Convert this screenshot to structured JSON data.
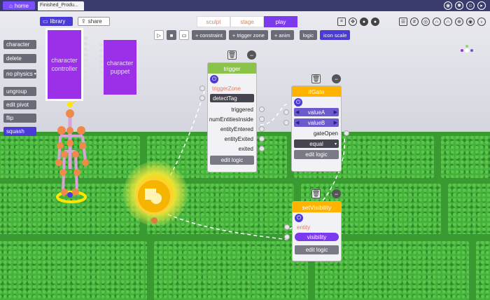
{
  "topbar": {
    "home_label": "home",
    "file_tab": "Finished_Produ...",
    "icons": [
      "github-icon",
      "settings-icon",
      "discord-icon",
      "youtube-icon"
    ]
  },
  "library": {
    "library_label": "library",
    "share_label": "share"
  },
  "mode_tabs": [
    {
      "label": "sculpt",
      "active": false
    },
    {
      "label": "stage",
      "active": false
    },
    {
      "label": "play",
      "active": true
    }
  ],
  "toolbar": {
    "constraint": "constraint",
    "trigger_zone": "trigger zone",
    "anim": "anim",
    "logic": "logic",
    "icon_scale": "icon scale"
  },
  "left_panel": {
    "character": "character",
    "delete": "delete",
    "physics": "no physics",
    "ungroup": "ungroup",
    "edit_pivot": "edit pivot",
    "flip": "flip",
    "squash": "squash"
  },
  "palette": {
    "controller": "character controller",
    "puppet": "character puppet"
  },
  "trigger_node": {
    "title": "trigger",
    "input_label": "triggerZone",
    "tag_field": "detectTag",
    "outputs": [
      "triggered",
      "numEntitiesInside",
      "entityEntered",
      "entityExited",
      "exited"
    ],
    "edit_logic": "edit logic"
  },
  "ifgate_node": {
    "title": "ifGate",
    "value_a": "valueA",
    "value_b": "valueB",
    "output": "gateOpen",
    "operator": "equal",
    "edit_logic": "edit logic"
  },
  "setvis_node": {
    "title": "setVisibility",
    "input_label": "entity",
    "toggle_label": "visibility",
    "edit_logic": "edit logic"
  },
  "colors": {
    "accent_purple": "#7c3aed",
    "trigger_header": "#8bc34a",
    "gate_header": "#ffb300",
    "grass": "#45b23c"
  }
}
